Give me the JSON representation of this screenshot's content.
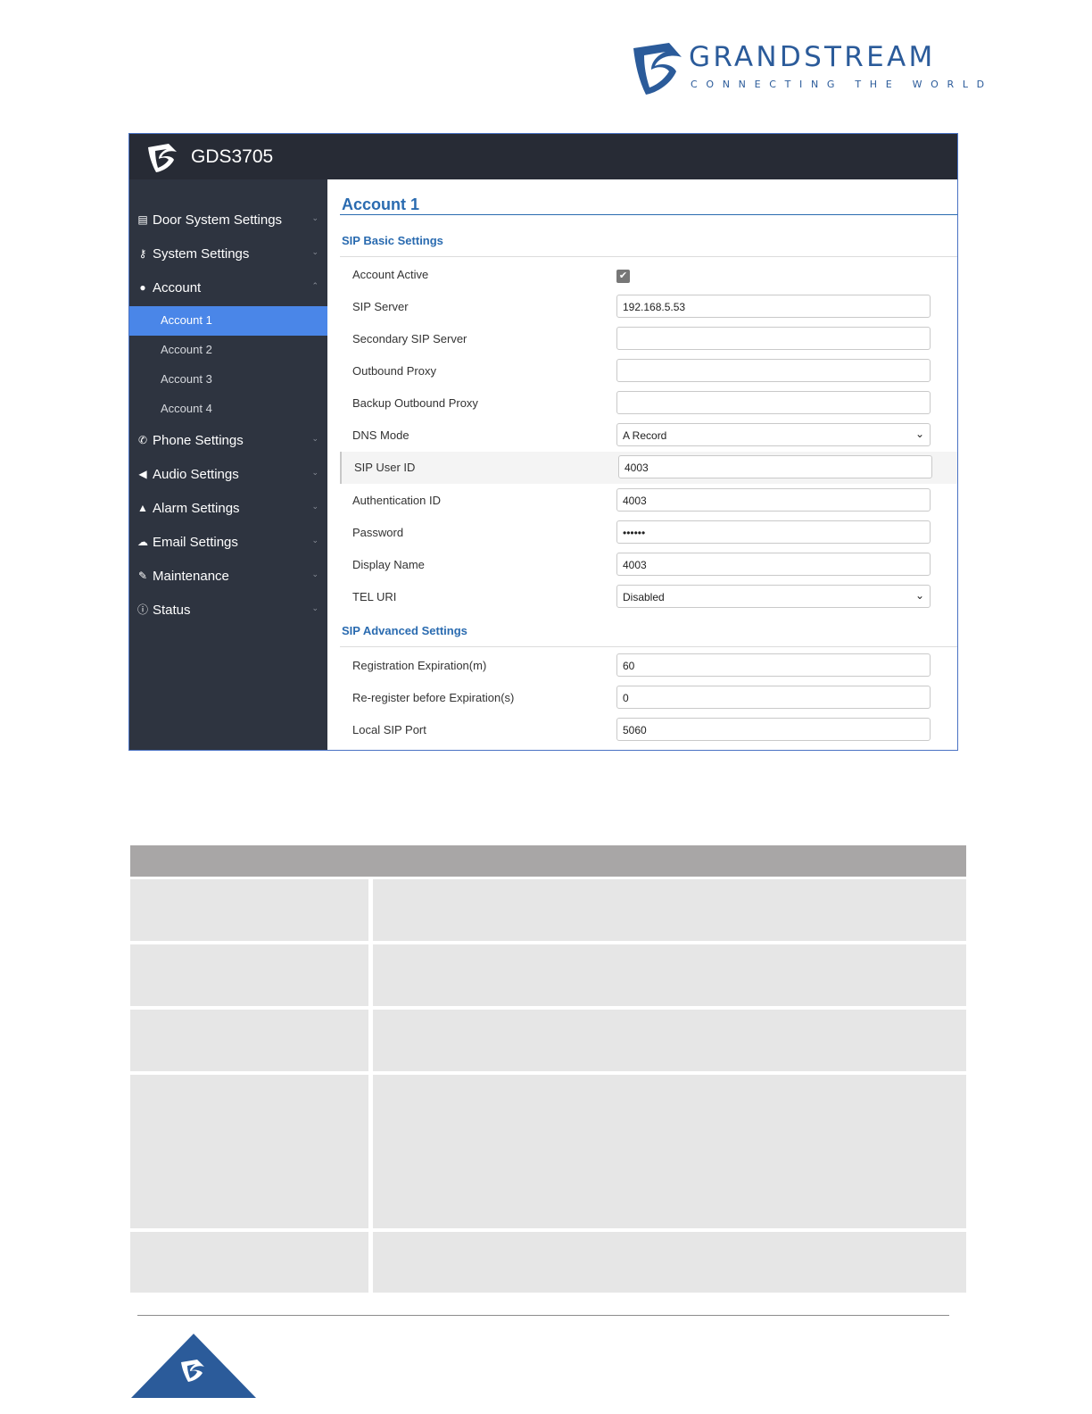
{
  "brand": {
    "name": "GRANDSTREAM",
    "tagline": "CONNECTING THE WORLD",
    "color": "#2b5b9a"
  },
  "app": {
    "title": "GDS3705",
    "accent": "#4a86e8"
  },
  "sidebar": {
    "items": [
      {
        "label": "Door System Settings",
        "icon": "door-panel-icon",
        "chevron": "⌄"
      },
      {
        "label": "System Settings",
        "icon": "key-icon",
        "chevron": "⌄"
      },
      {
        "label": "Account",
        "icon": "user-icon",
        "chevron": "⌃"
      },
      {
        "label": "Phone Settings",
        "icon": "phone-icon",
        "chevron": "⌄"
      },
      {
        "label": "Audio Settings",
        "icon": "speaker-icon",
        "chevron": "⌄"
      },
      {
        "label": "Alarm Settings",
        "icon": "bell-icon",
        "chevron": "⌄"
      },
      {
        "label": "Email Settings",
        "icon": "cloud-icon",
        "chevron": "⌄"
      },
      {
        "label": "Maintenance",
        "icon": "wrench-icon",
        "chevron": "⌄"
      },
      {
        "label": "Status",
        "icon": "info-icon",
        "chevron": "⌄"
      }
    ],
    "sub_items": [
      {
        "label": "Account 1"
      },
      {
        "label": "Account 2"
      },
      {
        "label": "Account 3"
      },
      {
        "label": "Account 4"
      }
    ]
  },
  "main": {
    "title": "Account 1",
    "basic_section": "SIP Basic Settings",
    "advanced_section": "SIP Advanced Settings",
    "account_active": {
      "label": "Account Active",
      "checked": true
    },
    "sip_server": {
      "label": "SIP Server",
      "value": "192.168.5.53"
    },
    "secondary_sip_server": {
      "label": "Secondary SIP Server",
      "value": ""
    },
    "outbound_proxy": {
      "label": "Outbound Proxy",
      "value": ""
    },
    "backup_outbound_proxy": {
      "label": "Backup Outbound Proxy",
      "value": ""
    },
    "dns_mode": {
      "label": "DNS Mode",
      "value": "A Record"
    },
    "sip_user_id": {
      "label": "SIP User ID",
      "value": "4003"
    },
    "authentication_id": {
      "label": "Authentication ID",
      "value": "4003"
    },
    "password": {
      "label": "Password",
      "value": "••••••"
    },
    "display_name": {
      "label": "Display Name",
      "value": "4003"
    },
    "tel_uri": {
      "label": "TEL URI",
      "value": "Disabled"
    },
    "registration_expiration": {
      "label": "Registration Expiration(m)",
      "value": "60"
    },
    "reregister_before_expiration": {
      "label": "Re-register before Expiration(s)",
      "value": "0"
    },
    "local_sip_port": {
      "label": "Local SIP Port",
      "value": "5060"
    }
  }
}
